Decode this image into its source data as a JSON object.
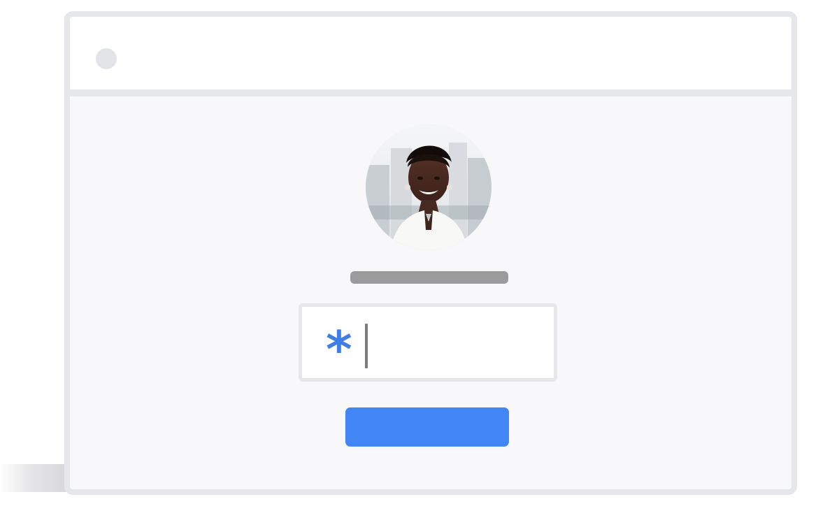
{
  "window": {
    "title_dot": "window-dot"
  },
  "profile": {
    "avatar_icon": "profile-photo"
  },
  "password": {
    "value": "*",
    "cursor": "text-cursor"
  },
  "button": {
    "label": ""
  },
  "colors": {
    "window_border": "#e6e7ea",
    "content_background": "#f8f8fa",
    "accent": "#4285f4",
    "asterisk": "#3f7fe5",
    "name_placeholder": "#9b9b9b"
  }
}
